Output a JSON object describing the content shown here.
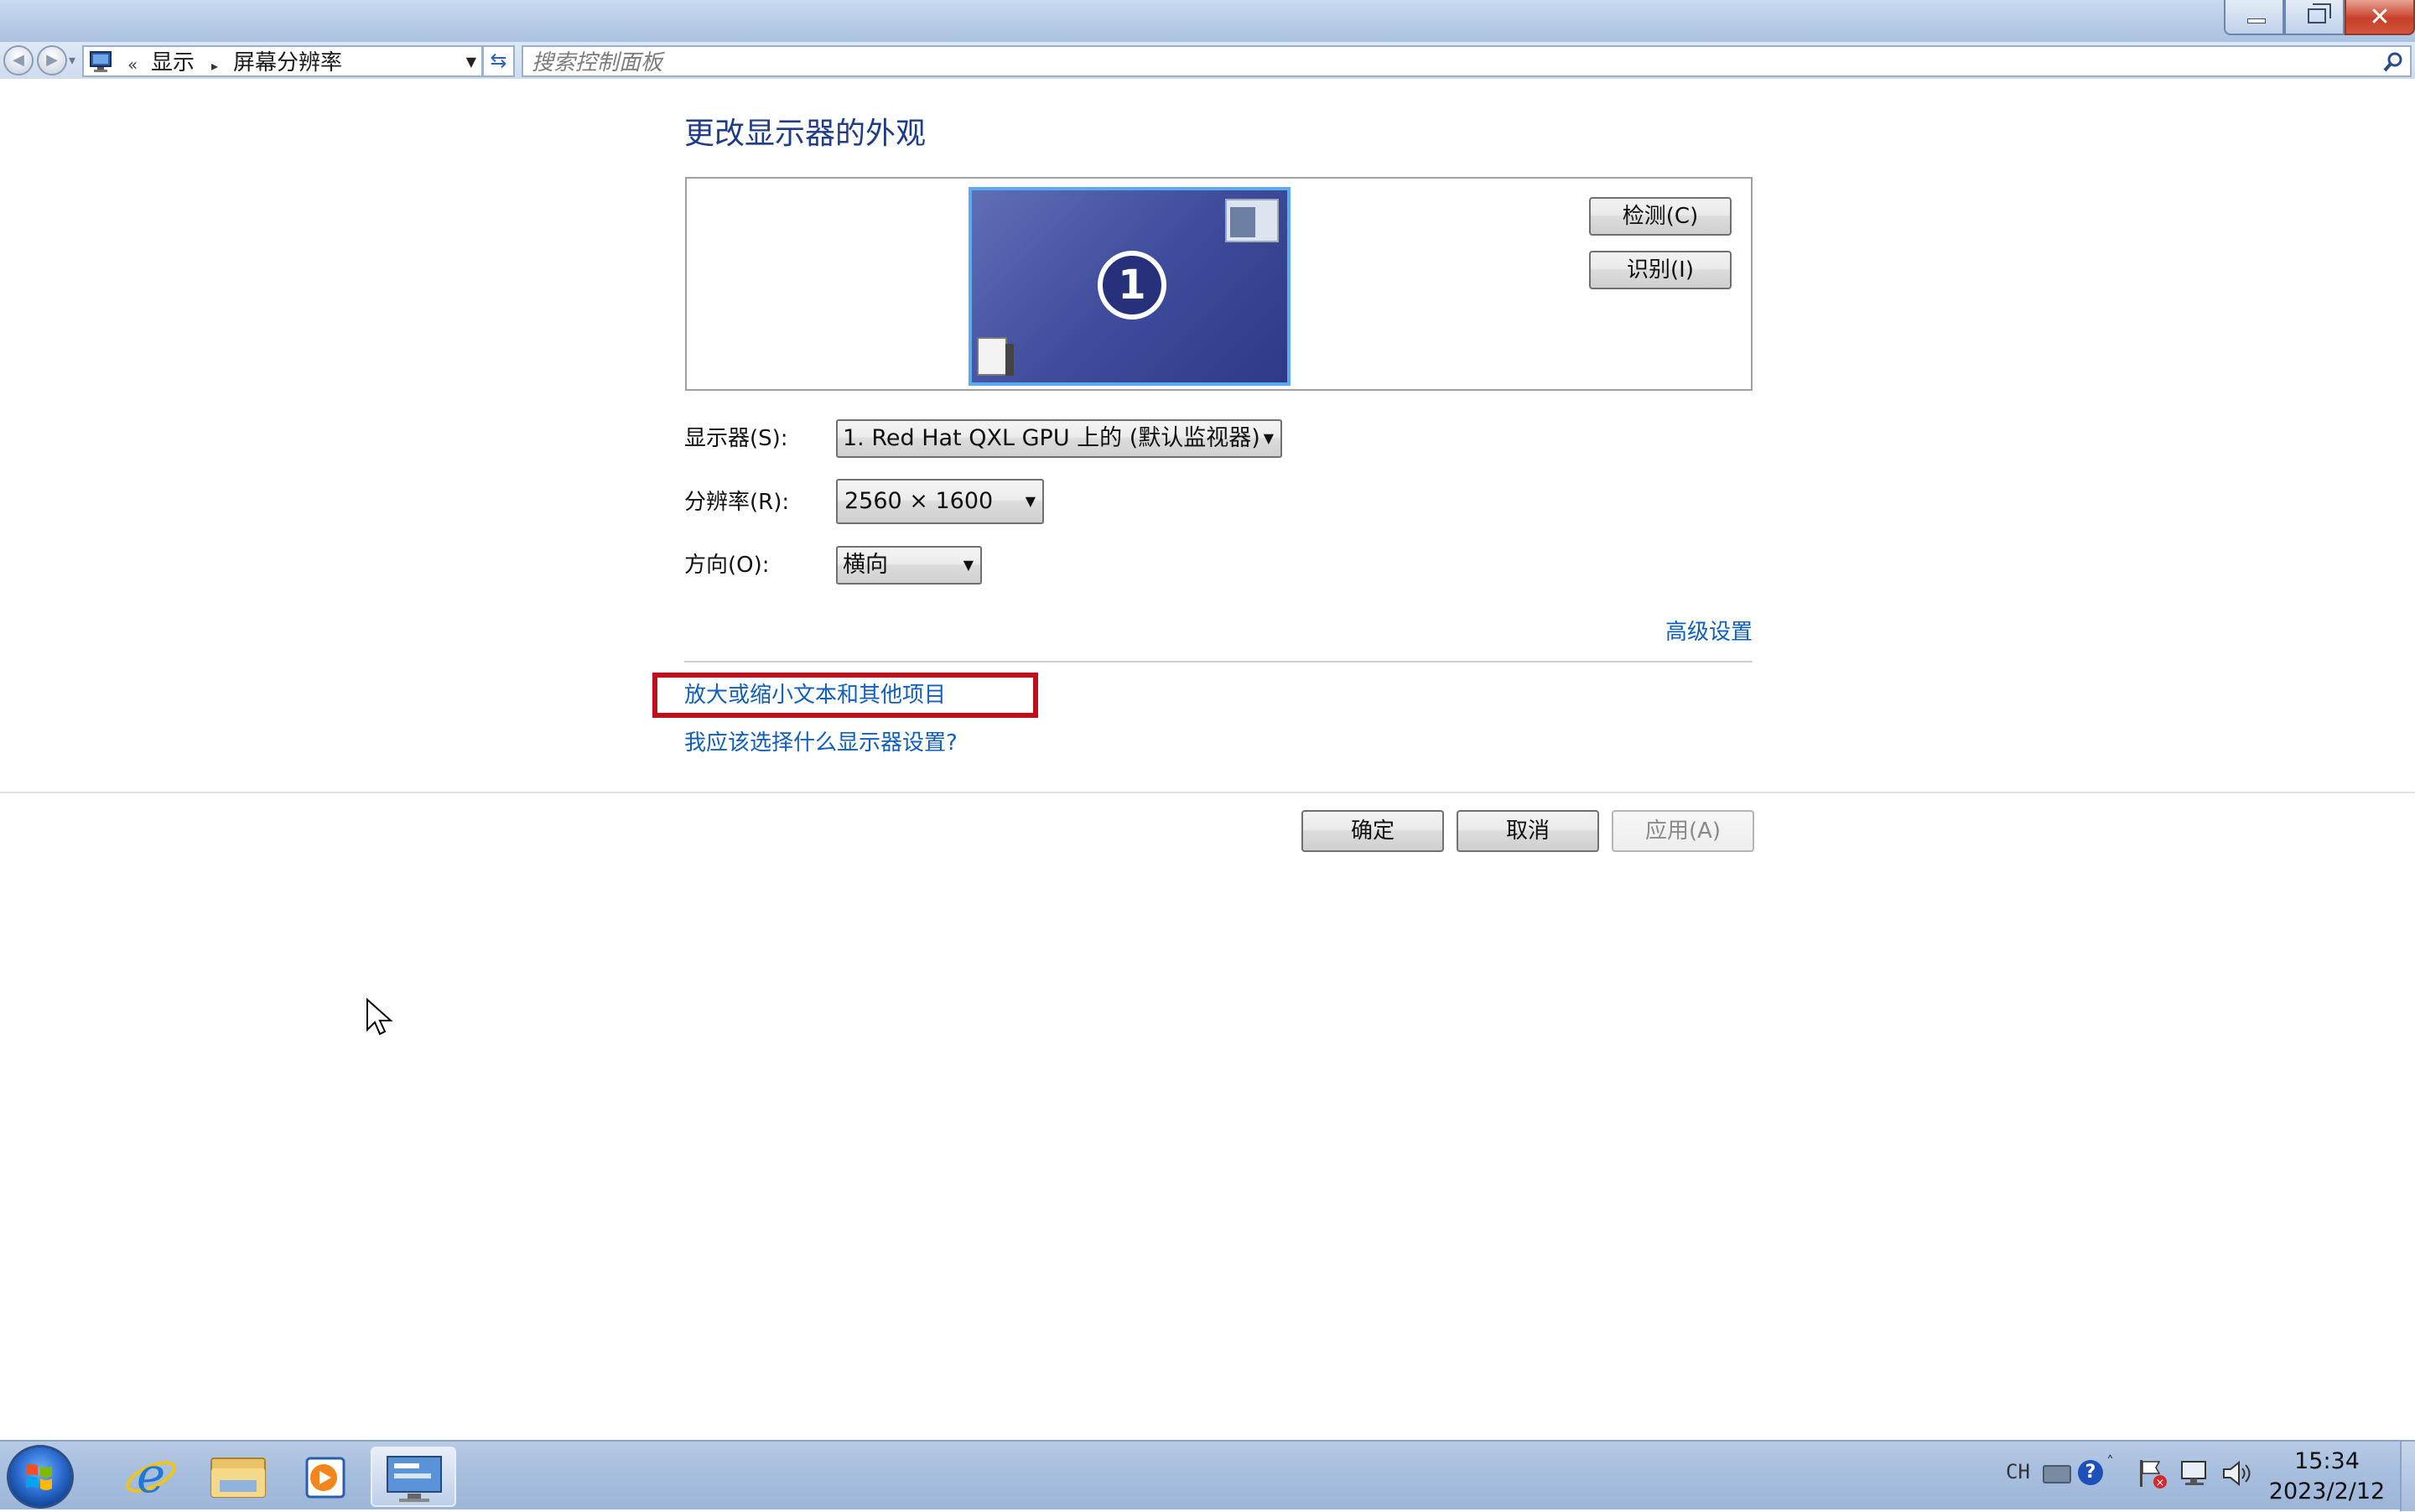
{
  "window": {
    "minimize_icon": "minimize-icon",
    "maximize_icon": "restore-icon",
    "close_icon": "close-icon",
    "close_glyph": "✕"
  },
  "navigation": {
    "back_icon": "back-arrow-icon",
    "forward_icon": "forward-arrow-icon",
    "address": {
      "icon": "display-control-panel-icon",
      "overflow_marker": "«",
      "crumbs": [
        "显示",
        "屏幕分辨率"
      ],
      "separator": "▸"
    },
    "refresh_icon": "refresh-icon",
    "search": {
      "placeholder": "搜索控制面板",
      "icon": "search-icon"
    }
  },
  "main": {
    "title": "更改显示器的外观",
    "monitor_preview": {
      "number": "1",
      "background_color": "#3f4d9c",
      "border_color": "#5eaaf0"
    },
    "detect_button": "检测(C)",
    "identify_button": "识别(I)",
    "display_label": "显示器(S):",
    "display_value": "1. Red Hat QXL GPU 上的 (默认监视器)",
    "resolution_label": "分辨率(R):",
    "resolution_value": "2560 × 1600",
    "orientation_label": "方向(O):",
    "orientation_value": "横向",
    "advanced_link": "高级设置",
    "zoom_text_link": "放大或缩小文本和其他项目",
    "which_settings_link": "我应该选择什么显示器设置?",
    "highlight_color": "#c0101c",
    "link_color": "#0f5fbf",
    "ok_button": "确定",
    "cancel_button": "取消",
    "apply_button": "应用(A)"
  },
  "taskbar": {
    "start_icon": "windows-start-icon",
    "pinned": [
      {
        "name": "internet-explorer-icon"
      },
      {
        "name": "windows-explorer-icon"
      },
      {
        "name": "media-player-icon"
      },
      {
        "name": "control-panel-icon",
        "active": true
      }
    ],
    "tray": {
      "language": "CH",
      "keyboard_icon": "keyboard-icon",
      "help_icon": "help-icon",
      "help_glyph": "?",
      "overflow_glyph": "˄",
      "action_center_icon": "action-center-flag-icon",
      "network_icon": "network-icon",
      "volume_icon": "volume-icon",
      "time": "15:34",
      "date": "2023/2/12"
    }
  }
}
